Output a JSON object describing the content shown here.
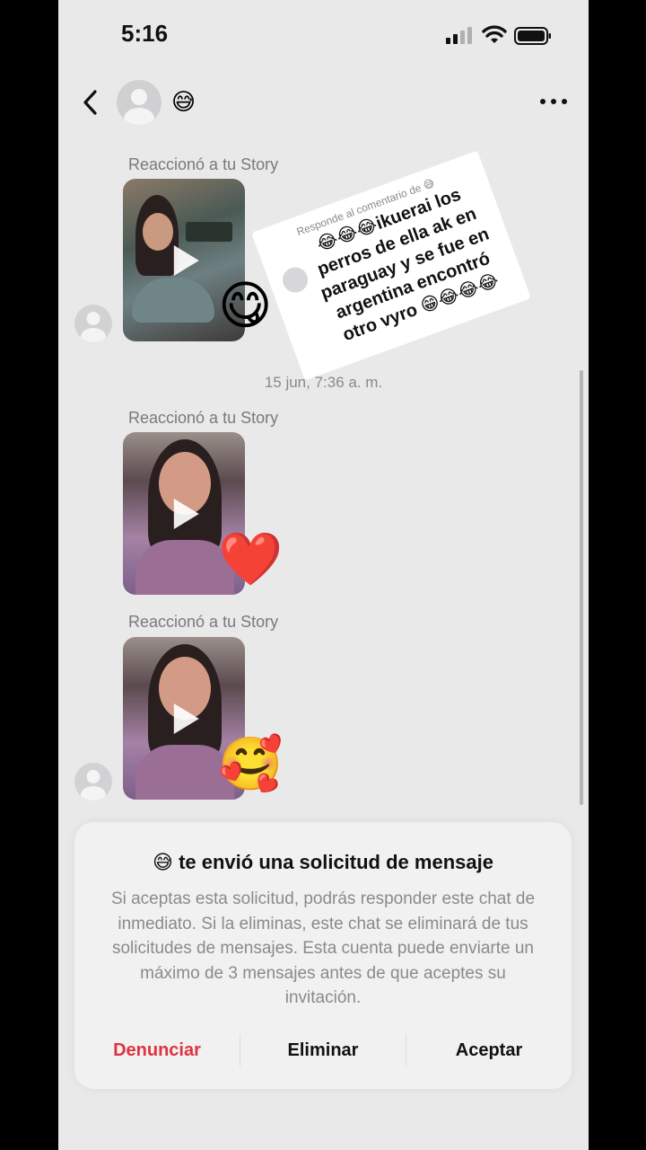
{
  "status_bar": {
    "time": "5:16"
  },
  "header": {
    "name_emoji": "😅"
  },
  "messages": [
    {
      "label": "Reaccionó a tu Story",
      "reaction": "😋"
    },
    {
      "timestamp": "15 jun, 7:36 a. m."
    },
    {
      "label": "Reaccionó a tu Story",
      "reaction": "❤️"
    },
    {
      "label": "Reaccionó a tu Story",
      "reaction": "🥰"
    }
  ],
  "sticker": {
    "header": "Responde al comentario de 😅",
    "text": "😂😂😂ikuerai los perros de ella ak en paraguay y se fue en argentina encontró otro vyro 😁😂😂😂"
  },
  "request": {
    "title": "😅 te envió una solicitud de mensaje",
    "body": "Si aceptas esta solicitud, podrás responder este chat de inmediato. Si la eliminas, este chat se eliminará de tus solicitudes de mensajes. Esta cuenta puede enviarte un máximo de 3 mensajes antes de que aceptes su invitación.",
    "report_label": "Denunciar",
    "delete_label": "Eliminar",
    "accept_label": "Aceptar"
  },
  "colors": {
    "report": "#e0323f",
    "background": "#e9e9ea"
  }
}
